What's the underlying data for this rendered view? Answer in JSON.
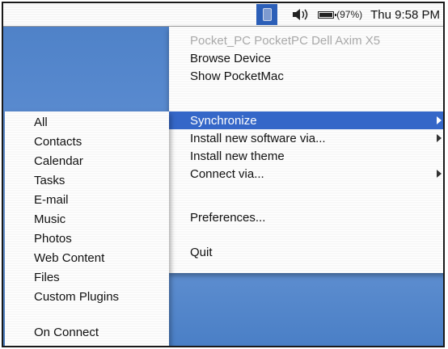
{
  "menubar": {
    "app_icon": "pocketmac-icon",
    "volume_icon": "volume-icon",
    "battery_icon": "battery-icon",
    "battery_percent_text": "(97%)",
    "battery_level": 0.97,
    "clock": "Thu 9:58 PM"
  },
  "menu": {
    "device_name": "Pocket_PC PocketPC Dell Axim X5",
    "browse_device": "Browse Device",
    "show_pocketmac": "Show PocketMac",
    "synchronize": "Synchronize",
    "install_software": "Install new software via...",
    "install_theme": "Install new theme",
    "connect_via": "Connect via...",
    "preferences": "Preferences...",
    "quit": "Quit"
  },
  "submenu": {
    "items": [
      "All",
      "Contacts",
      "Calendar",
      "Tasks",
      "E-mail",
      "Music",
      "Photos",
      "Web Content",
      "Files",
      "Custom Plugins"
    ],
    "on_connect": "On Connect"
  },
  "colors": {
    "selection": "#3567c8",
    "desktop": "#5a8bd0",
    "disabled_text": "#a9a9a9"
  }
}
